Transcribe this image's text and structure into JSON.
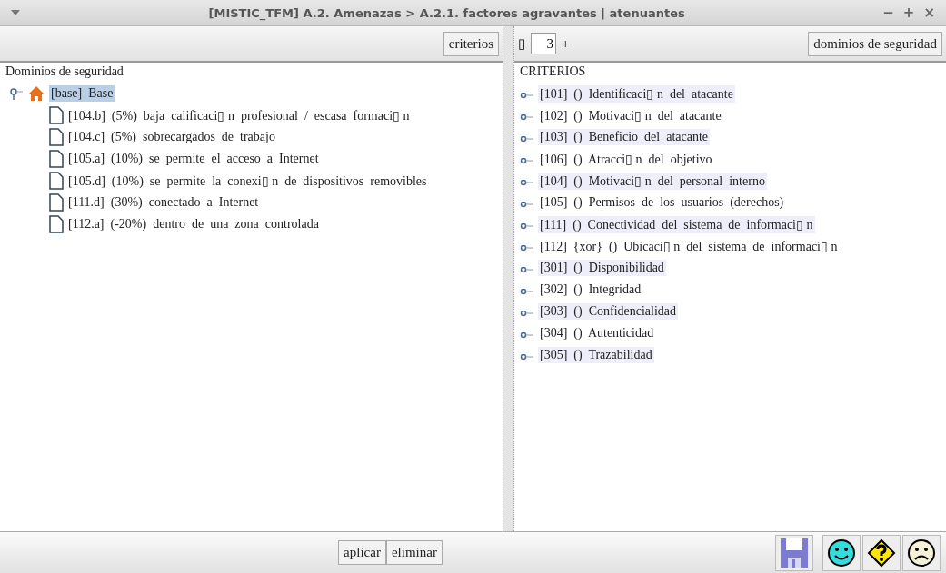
{
  "window": {
    "title": "[MISTIC_TFM] A.2. Amenazas > A.2.1. factores agravantes | atenuantes",
    "controls": [
      "−",
      "+",
      "×"
    ]
  },
  "left_panel": {
    "toolbar_button": "criterios",
    "heading": "Dominios de seguridad",
    "tree": [
      {
        "label": "[base]  Base",
        "selected": true,
        "expanded": true,
        "children": [
          {
            "label": "[104.b]  (5%)  baja  calificaci▯ n  profesional  /  escasa  formaci▯ n",
            "selected": false
          },
          {
            "label": "[104.c]  (5%)  sobrecargados  de  trabajo",
            "selected": false
          },
          {
            "label": "[105.a]  (10%)  se  permite  el  acceso  a  Internet",
            "selected": false
          },
          {
            "label": "[105.d]  (10%)  se  permite  la  conexi▯ n  de  dispositivos  removibles",
            "selected": false
          },
          {
            "label": "[111.d]  (30%)  conectado  a  Internet",
            "selected": false
          },
          {
            "label": "[112.a]  (-20%)  dentro  de  una  zona  controlada",
            "selected": false
          }
        ]
      }
    ]
  },
  "right_panel": {
    "decrement": "▯",
    "depth_value": "3",
    "increment": "+",
    "toolbar_button": "dominios de seguridad",
    "heading": "CRITERIOS",
    "items": [
      "[101]  ()  Identificaci▯ n  del  atacante",
      "[102]  ()  Motivaci▯ n  del  atacante",
      "[103]  ()  Beneficio  del  atacante",
      "[106]  ()  Atracci▯ n  del  objetivo",
      "[104]  ()  Motivaci▯ n  del  personal  interno",
      "[105]  ()  Permisos  de  los  usuarios  (derechos)",
      "[111]  ()  Conectividad  del  sistema  de  informaci▯ n",
      "[112]  {xor}  ()  Ubicaci▯ n  del  sistema  de  informaci▯ n",
      "[301]  ()  Disponibilidad",
      "[302]  ()  Integridad",
      "[303]  ()  Confidencialidad",
      "[304]  ()  Autenticidad",
      "[305]  ()  Trazabilidad"
    ]
  },
  "bottom_bar": {
    "buttons": [
      "aplicar",
      "eliminar"
    ],
    "icon_buttons": [
      {
        "kind": "save"
      },
      {
        "kind": "happy"
      },
      {
        "kind": "question"
      },
      {
        "kind": "sad"
      }
    ]
  }
}
